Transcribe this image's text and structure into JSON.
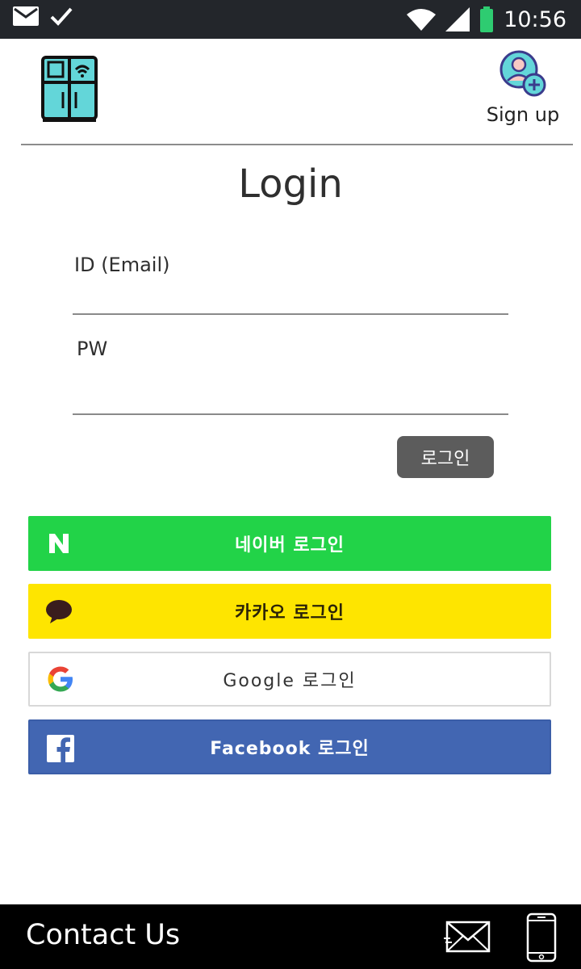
{
  "status_bar": {
    "time": "10:56",
    "icons": [
      "mail-icon",
      "check-icon",
      "wifi-icon",
      "signal-icon",
      "battery-icon"
    ],
    "battery_color": "#2ecc71"
  },
  "header": {
    "logo_icon": "smart-fridge-icon",
    "signup_icon": "add-user-icon",
    "signup_label": "Sign up"
  },
  "login": {
    "title": "Login",
    "id_label": "ID (Email)",
    "id_value": "",
    "pw_label": "PW",
    "pw_value": "",
    "submit_label": "로그인",
    "submit_color": "#5c5c5c"
  },
  "social": [
    {
      "key": "naver",
      "label": "네이버 로그인",
      "icon": "naver-icon",
      "color": "#22d348"
    },
    {
      "key": "kakao",
      "label": "카카오 로그인",
      "icon": "kakao-icon",
      "color": "#fee500"
    },
    {
      "key": "google",
      "label": "Google 로그인",
      "icon": "google-icon",
      "color": "#ffffff"
    },
    {
      "key": "facebook",
      "label": "Facebook 로그인",
      "icon": "facebook-icon",
      "color": "#4266b2"
    }
  ],
  "footer": {
    "contact_label": "Contact Us",
    "icons": [
      "mail-icon",
      "phone-icon"
    ]
  }
}
